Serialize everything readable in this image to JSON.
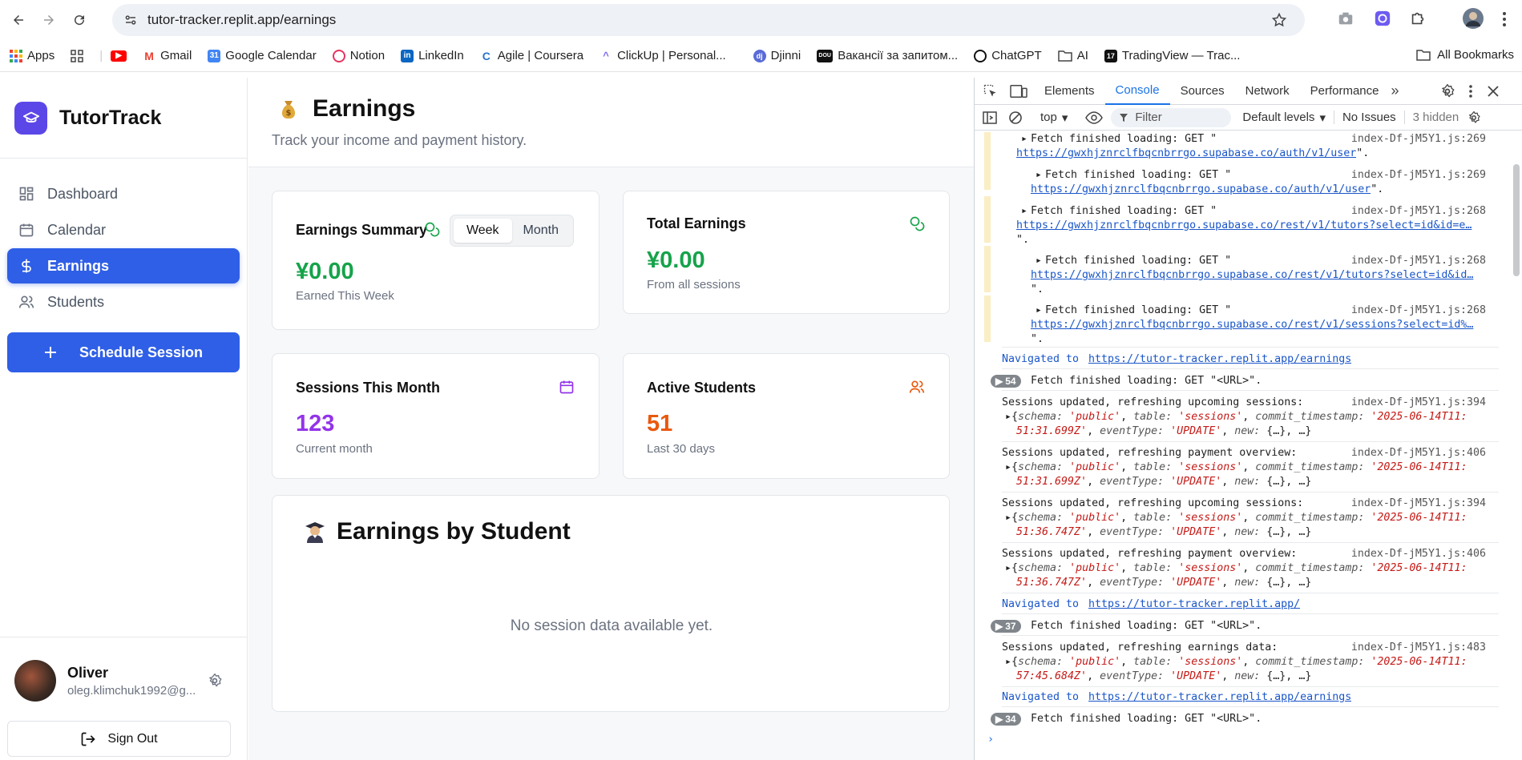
{
  "browser": {
    "url": "tutor-tracker.replit.app/earnings",
    "bookmarks": [
      "Apps",
      "Gmail",
      "Google Calendar",
      "Notion",
      "LinkedIn",
      "Agile | Coursera",
      "ClickUp | Personal...",
      "Djinni",
      "Вакансії за запитом...",
      "ChatGPT",
      "AI",
      "TradingView — Trac..."
    ],
    "all_bookmarks": "All Bookmarks"
  },
  "app": {
    "brand": "TutorTrack",
    "nav": [
      "Dashboard",
      "Calendar",
      "Earnings",
      "Students"
    ],
    "schedule_label": "Schedule Session",
    "user": {
      "name": "Oliver",
      "email": "oleg.klimchuk1992@g..."
    },
    "sign_out": "Sign Out"
  },
  "page": {
    "title": "Earnings",
    "subtitle": "Track your income and payment history."
  },
  "cards": {
    "summary": {
      "title": "Earnings Summary",
      "week": "Week",
      "month": "Month",
      "value": "¥0.00",
      "label": "Earned This Week"
    },
    "total": {
      "title": "Total Earnings",
      "value": "¥0.00",
      "label": "From all sessions"
    },
    "sessions": {
      "title": "Sessions This Month",
      "value": "123",
      "label": "Current month"
    },
    "students": {
      "title": "Active Students",
      "value": "51",
      "label": "Last 30 days"
    }
  },
  "by_student": {
    "title": "Earnings by Student",
    "empty": "No session data available yet."
  },
  "devtools": {
    "tabs": [
      "Elements",
      "Console",
      "Sources",
      "Network",
      "Performance"
    ],
    "context": "top",
    "filter": "Filter",
    "levels": "Default levels",
    "issues": "No Issues",
    "hidden": "3 hidden",
    "logs": [
      {
        "msg": "Fetch finished loading: GET \"",
        "link": "https://gwxhjznrclfbqcnbrrgo.supabase.co/auth/v1/user",
        "tail": "\".",
        "src": "index-Df-jM5Y1.js:269"
      },
      {
        "msg": "Fetch finished loading: GET \"",
        "link": "https://gwxhjznrclfbqcnbrrgo.supabase.co/auth/v1/user",
        "tail": "\".",
        "src": "index-Df-jM5Y1.js:269"
      },
      {
        "msg": "Fetch finished loading: GET \"",
        "link": "https://gwxhjznrclfbqcnbrrgo.supabase.co/rest/v1/tutors?select=id&id=e…",
        "tail": "\".",
        "src": "index-Df-jM5Y1.js:268"
      },
      {
        "msg": "Fetch finished loading: GET \"",
        "link": "https://gwxhjznrclfbqcnbrrgo.supabase.co/rest/v1/tutors?select=id&id…",
        "tail": "\".",
        "src": "index-Df-jM5Y1.js:268"
      },
      {
        "msg": "Fetch finished loading: GET \"",
        "link": "https://gwxhjznrclfbqcnbrrgo.supabase.co/rest/v1/sessions?select=id%…",
        "tail": "\".",
        "src": "index-Df-jM5Y1.js:268"
      }
    ],
    "nav1": {
      "pre": "Navigated to ",
      "link": "https://tutor-tracker.replit.app/earnings"
    },
    "count1": {
      "n": "54",
      "msg": "Fetch finished loading: GET \"<URL>\"."
    },
    "updates": [
      {
        "msg": "Sessions updated, refreshing upcoming sessions:",
        "src": "index-Df-jM5Y1.js:394",
        "ts1": "'2025-06-14T11:",
        "ts2": "51:31.699Z'"
      },
      {
        "msg": "Sessions updated, refreshing payment overview:",
        "src": "index-Df-jM5Y1.js:406",
        "ts1": "'2025-06-14T11:",
        "ts2": "51:31.699Z'"
      },
      {
        "msg": "Sessions updated, refreshing upcoming sessions:",
        "src": "index-Df-jM5Y1.js:394",
        "ts1": "'2025-06-14T11:",
        "ts2": "51:36.747Z'"
      },
      {
        "msg": "Sessions updated, refreshing payment overview:",
        "src": "index-Df-jM5Y1.js:406",
        "ts1": "'2025-06-14T11:",
        "ts2": "51:36.747Z'"
      }
    ],
    "nav2": {
      "pre": "Navigated to ",
      "link": "https://tutor-tracker.replit.app/"
    },
    "count2": {
      "n": "37",
      "msg": "Fetch finished loading: GET \"<URL>\"."
    },
    "update5": {
      "msg": "Sessions updated, refreshing earnings data:",
      "src": "index-Df-jM5Y1.js:483",
      "ts1": "'2025-06-14T11:",
      "ts2": "57:45.684Z'"
    },
    "nav3": {
      "pre": "Navigated to ",
      "link": "https://tutor-tracker.replit.app/earnings"
    },
    "count3": {
      "n": "34",
      "msg": "Fetch finished loading: GET \"<URL>\"."
    },
    "obj": {
      "schema_key": "schema",
      "schema_val": "'public'",
      "table_key": "table",
      "table_val": "'sessions'",
      "ts_key": "commit_timestamp",
      "ev_key": "eventType",
      "ev_val": "'UPDATE'",
      "new_key": "new",
      "new_val": "{…}",
      "rest": "…"
    }
  },
  "colors": {
    "accent": "#2f5fe6",
    "green": "#16a34a",
    "purple": "#9333ea",
    "orange": "#ea580c"
  }
}
